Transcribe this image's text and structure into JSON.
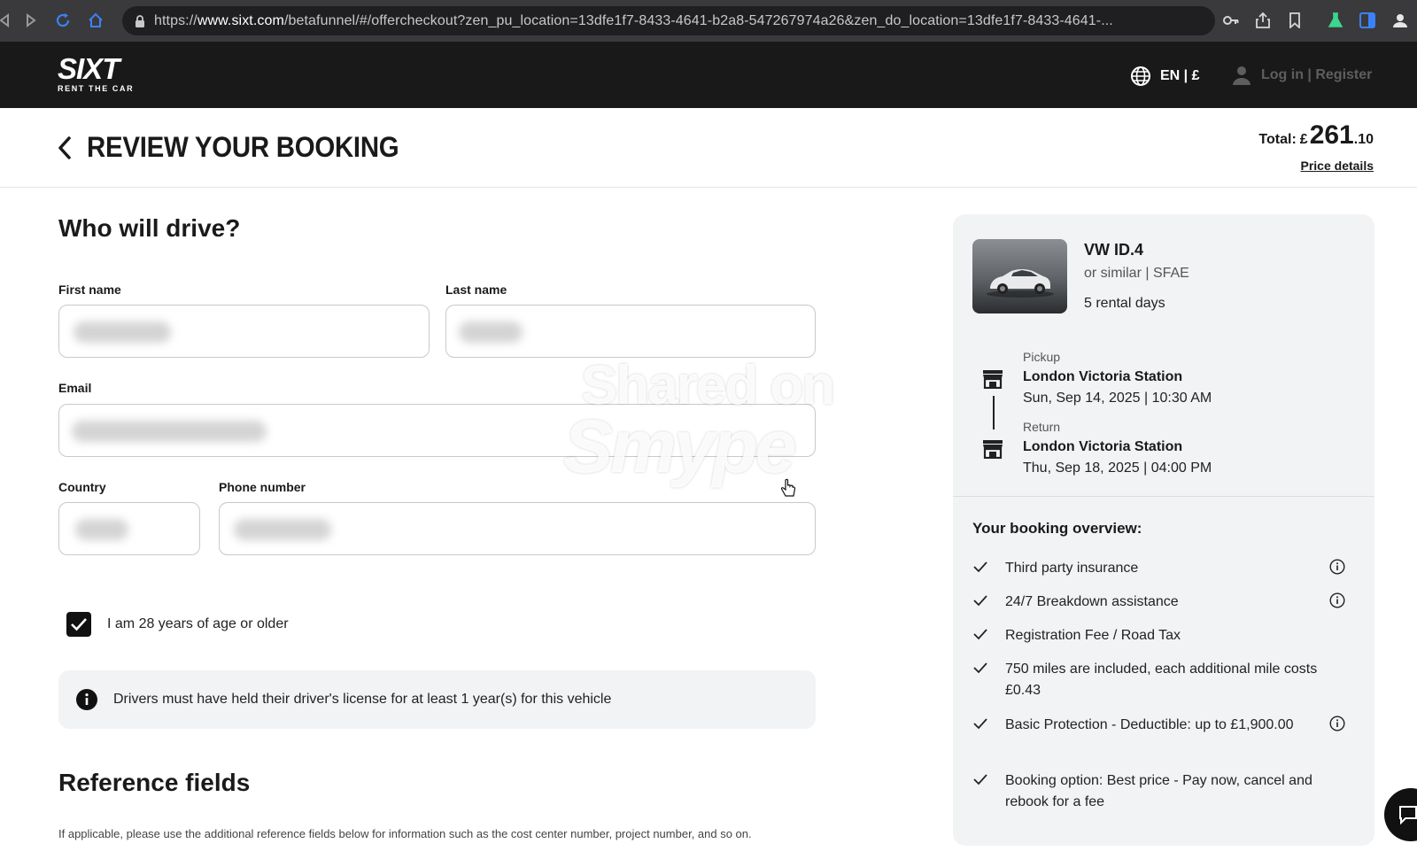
{
  "browser": {
    "url_prefix": "https://",
    "url_domain": "www.sixt.com",
    "url_rest": "/betafunnel/#/offercheckout?zen_pu_location=13dfe1f7-8433-4641-b2a8-547267974a26&zen_do_location=13dfe1f7-8433-4641-..."
  },
  "header": {
    "logo_main": "SIXT",
    "logo_sub": "RENT THE CAR",
    "language": "EN | £",
    "login": "Log in | Register"
  },
  "page": {
    "title": "REVIEW YOUR BOOKING",
    "total_label": "Total:",
    "total_currency": "£",
    "total_int": "261",
    "total_dec": ".10",
    "price_details": "Price details"
  },
  "form": {
    "section_title": "Who will drive?",
    "first_name_label": "First name",
    "last_name_label": "Last name",
    "email_label": "Email",
    "country_label": "Country",
    "phone_label": "Phone number",
    "age_checkbox_label": "I am 28 years of age or older",
    "age_checked": true,
    "license_notice": "Drivers must have held their driver's license for at least 1 year(s) for this vehicle",
    "reference_title": "Reference fields",
    "reference_text": "If applicable, please use the additional reference fields below for information such as the cost center number, project number, and so on."
  },
  "watermark": {
    "line1": "Shared on",
    "line2": "Smype"
  },
  "summary": {
    "car_name": "VW ID.4",
    "car_sub": "or similar | SFAE",
    "rental_days": "5 rental days",
    "pickup_label": "Pickup",
    "pickup_location": "London Victoria Station",
    "pickup_time": "Sun, Sep 14, 2025 | 10:30 AM",
    "return_label": "Return",
    "return_location": "London Victoria Station",
    "return_time": "Thu, Sep 18, 2025 | 04:00 PM",
    "overview_title": "Your booking overview:",
    "items": [
      {
        "text": "Third party insurance",
        "info": true
      },
      {
        "text": "24/7 Breakdown assistance",
        "info": true
      },
      {
        "text": "Registration Fee / Road Tax",
        "info": false
      },
      {
        "text": "750 miles are included, each additional mile costs £0.43",
        "info": false
      },
      {
        "text": "Basic Protection - Deductible: up to £1,900.00",
        "info": true
      },
      {
        "text": "Booking option: Best price - Pay now, cancel and rebook for a fee",
        "info": false
      }
    ]
  },
  "colors": {
    "header_bg": "#191919",
    "panel_bg": "#f2f3f5",
    "browser_bg": "#3a3a3c"
  }
}
